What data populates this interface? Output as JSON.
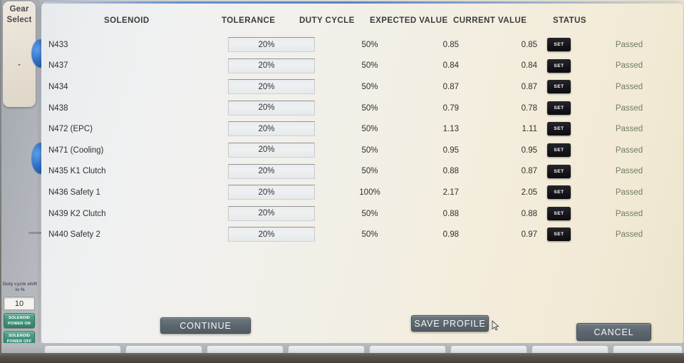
{
  "left_rail": {
    "gear_select_line1": "Gear",
    "gear_select_line2": "Select",
    "gear_value": "-",
    "duty_shift_label": "Duty cycle shift in %",
    "duty_shift_value": "10",
    "solenoid_power_on": "SOLENOID POWER ON",
    "solenoid_power_off": "SOLENOID POWER OFF"
  },
  "table": {
    "headers": {
      "solenoid": "SOLENOID",
      "tolerance": "TOLERANCE",
      "duty_cycle": "DUTY CYCLE",
      "expected_value": "EXPECTED VALUE",
      "current_value": "CURRENT VALUE",
      "status": "STATUS"
    },
    "set_label": "SET",
    "rows": [
      {
        "solenoid": "N433",
        "tolerance": "20%",
        "duty_cycle": "50%",
        "expected": "0.85",
        "current": "0.85",
        "status": "Passed"
      },
      {
        "solenoid": "N437",
        "tolerance": "20%",
        "duty_cycle": "50%",
        "expected": "0.84",
        "current": "0.84",
        "status": "Passed"
      },
      {
        "solenoid": "N434",
        "tolerance": "20%",
        "duty_cycle": "50%",
        "expected": "0.87",
        "current": "0.87",
        "status": "Passed"
      },
      {
        "solenoid": "N438",
        "tolerance": "20%",
        "duty_cycle": "50%",
        "expected": "0.79",
        "current": "0.78",
        "status": "Passed"
      },
      {
        "solenoid": "N472 (EPC)",
        "tolerance": "20%",
        "duty_cycle": "50%",
        "expected": "1.13",
        "current": "1.11",
        "status": "Passed"
      },
      {
        "solenoid": "N471 (Cooling)",
        "tolerance": "20%",
        "duty_cycle": "50%",
        "expected": "0.95",
        "current": "0.95",
        "status": "Passed"
      },
      {
        "solenoid": "N435 K1 Clutch",
        "tolerance": "20%",
        "duty_cycle": "50%",
        "expected": "0.88",
        "current": "0.87",
        "status": "Passed"
      },
      {
        "solenoid": "N436 Safety 1",
        "tolerance": "20%",
        "duty_cycle": "100%",
        "expected": "2.17",
        "current": "2.05",
        "status": "Passed"
      },
      {
        "solenoid": "N439 K2 Clutch",
        "tolerance": "20%",
        "duty_cycle": "50%",
        "expected": "0.88",
        "current": "0.88",
        "status": "Passed"
      },
      {
        "solenoid": "N440 Safety 2",
        "tolerance": "20%",
        "duty_cycle": "50%",
        "expected": "0.98",
        "current": "0.97",
        "status": "Passed"
      }
    ]
  },
  "footer": {
    "continue": "CONTINUE",
    "save_profile": "SAVE PROFILE",
    "cancel": "CANCEL"
  },
  "colors": {
    "set_button": "#15151a",
    "status_passed": "#6f7d63",
    "footer_button": "#5c666f",
    "power_button": "#3e9179"
  }
}
